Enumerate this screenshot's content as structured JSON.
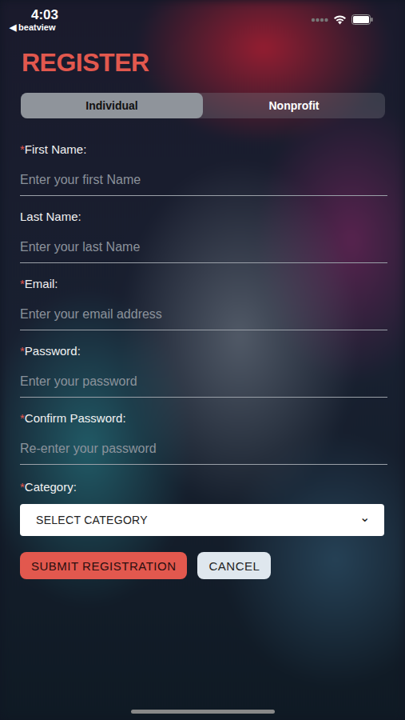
{
  "status_bar": {
    "time": "4:03",
    "back": "◀ beatview"
  },
  "title": "REGISTER",
  "tabs": [
    {
      "label": "Individual",
      "selected": true
    },
    {
      "label": "Nonprofit",
      "selected": false
    }
  ],
  "required_mark": "*",
  "fields": [
    {
      "label": "First Name:",
      "required": true,
      "placeholder": "Enter your first Name",
      "kind": "text"
    },
    {
      "label": "Last Name:",
      "required": false,
      "placeholder": "Enter your last Name",
      "kind": "text"
    },
    {
      "label": "Email:",
      "required": true,
      "placeholder": "Enter your email address",
      "kind": "email"
    },
    {
      "label": "Password:",
      "required": true,
      "placeholder": "Enter your password",
      "kind": "password"
    },
    {
      "label": "Confirm Password:",
      "required": true,
      "placeholder": "Re-enter your password",
      "kind": "password"
    }
  ],
  "category": {
    "label": "Category:",
    "required": true,
    "value": "SELECT CATEGORY",
    "chevron": "⌄"
  },
  "buttons": [
    {
      "label": "SUBMIT REGISTRATION",
      "kind": "primary"
    },
    {
      "label": "CANCEL",
      "kind": "secondary"
    }
  ]
}
